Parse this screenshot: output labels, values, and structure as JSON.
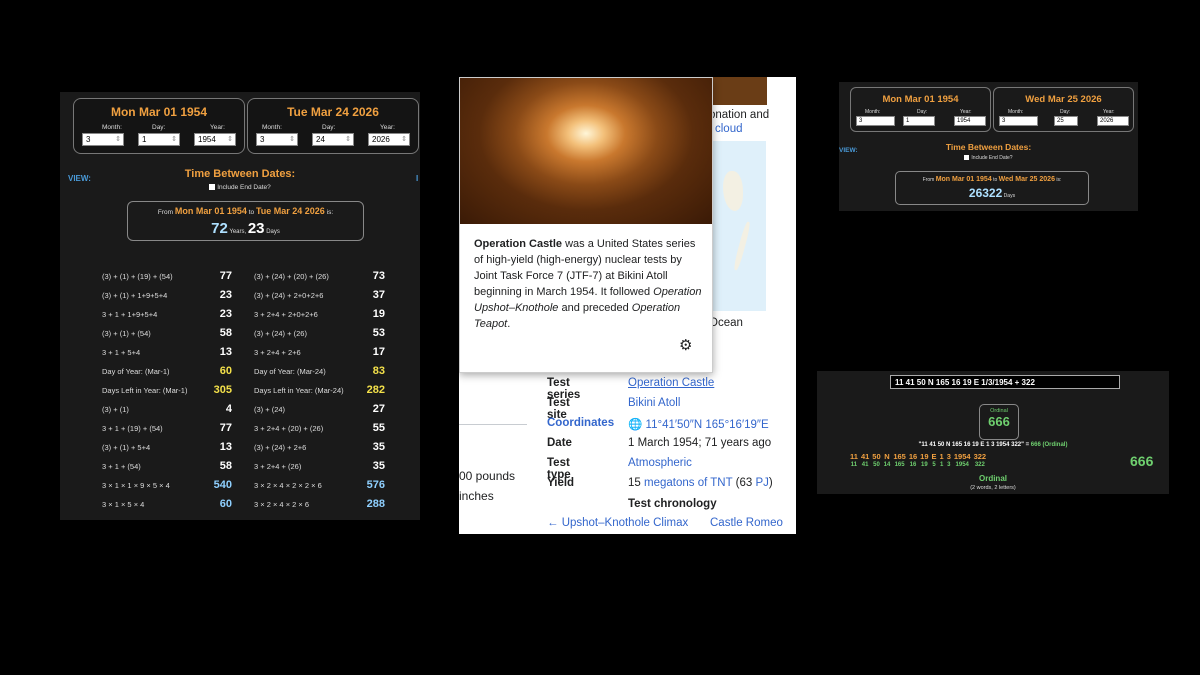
{
  "calc1": {
    "start": {
      "title": "Mon Mar 01 1954",
      "month": "3",
      "day": "1",
      "year": "1954"
    },
    "end": {
      "title": "Tue Mar 24 2026",
      "month": "3",
      "day": "24",
      "year": "2026"
    },
    "labels": {
      "month": "Month:",
      "day": "Day:",
      "year": "Year:"
    },
    "view": "VIEW:",
    "heading": "Time Between Dates:",
    "include": "Include End Date?",
    "from_word": "From",
    "to_word": "to",
    "is_word": "is:",
    "years": "72",
    "years_unit": "Years,",
    "days": "23",
    "days_unit": "Days",
    "left": [
      {
        "e": "(3) + (1) + (19) + (54)",
        "v": "77",
        "c": "cw"
      },
      {
        "e": "(3) + (1) + 1+9+5+4",
        "v": "23",
        "c": "cw"
      },
      {
        "e": "3 + 1 + 1+9+5+4",
        "v": "23",
        "c": "cw"
      },
      {
        "e": "(3) + (1) + (54)",
        "v": "58",
        "c": "cw"
      },
      {
        "e": "3 + 1 + 5+4",
        "v": "13",
        "c": "cw"
      },
      {
        "e": "Day of Year: (Mar-1)",
        "v": "60",
        "c": "cy"
      },
      {
        "e": "Days Left in Year: (Mar-1)",
        "v": "305",
        "c": "cy"
      },
      {
        "e": "(3) + (1)",
        "v": "4",
        "c": "cw"
      },
      {
        "e": "3 + 1 + (19) + (54)",
        "v": "77",
        "c": "cw"
      },
      {
        "e": "(3) + (1) + 5+4",
        "v": "13",
        "c": "cw"
      },
      {
        "e": "3 + 1 + (54)",
        "v": "58",
        "c": "cw"
      },
      {
        "e": "3 × 1 × 1 × 9 × 5 × 4",
        "v": "540",
        "c": "cb"
      },
      {
        "e": "3 × 1 × 5 × 4",
        "v": "60",
        "c": "cb"
      }
    ],
    "right": [
      {
        "e": "(3) + (24) + (20) + (26)",
        "v": "73",
        "c": "cw"
      },
      {
        "e": "(3) + (24) + 2+0+2+6",
        "v": "37",
        "c": "cw"
      },
      {
        "e": "3 + 2+4 + 2+0+2+6",
        "v": "19",
        "c": "cw"
      },
      {
        "e": "(3) + (24) + (26)",
        "v": "53",
        "c": "cw"
      },
      {
        "e": "3 + 2+4 + 2+6",
        "v": "17",
        "c": "cw"
      },
      {
        "e": "Day of Year: (Mar-24)",
        "v": "83",
        "c": "cy"
      },
      {
        "e": "Days Left in Year: (Mar-24)",
        "v": "282",
        "c": "cy"
      },
      {
        "e": "(3) + (24)",
        "v": "27",
        "c": "cw"
      },
      {
        "e": "3 + 2+4 + (20) + (26)",
        "v": "55",
        "c": "cw"
      },
      {
        "e": "(3) + (24) + 2+6",
        "v": "35",
        "c": "cw"
      },
      {
        "e": "3 + 2+4 + (26)",
        "v": "35",
        "c": "cw"
      },
      {
        "e": "3 × 2 × 4 × 2 × 2 × 6",
        "v": "576",
        "c": "cb"
      },
      {
        "e": "3 × 2 × 4 × 2 × 6",
        "v": "288",
        "c": "cb"
      }
    ]
  },
  "wiki": {
    "popup": {
      "title": "Operation Castle",
      "p1": " was a United States series of high-yield (high-energy) nuclear tests by Joint Task Force 7 (JTF-7) at Bikini Atoll beginning in March 1954. It followed ",
      "prev": "Operation Upshot–Knothole",
      "p2": " and preceded ",
      "next": "Operation Teapot",
      "p3": "."
    },
    "bg_text1": "onation and",
    "bg_link1": "cloud",
    "bg_ocean": "Ocean",
    "bg_pounds": "00 pounds",
    "bg_inches": "inches",
    "rows": [
      {
        "k": "Test series",
        "v": "Operation Castle",
        "link": true
      },
      {
        "k": "Test site",
        "v": "Bikini Atoll",
        "link": true
      },
      {
        "k": "Coordinates",
        "v": "11°41′50″N 165°16′19″E",
        "link": true
      },
      {
        "k": "Date",
        "v": "1 March 1954; 71 years ago",
        "link": false
      },
      {
        "k": "Test type",
        "v": "Atmospheric",
        "link": true
      },
      {
        "k": "Yield",
        "v": "15",
        "link": false
      }
    ],
    "yield_link": "megatons of TNT",
    "yield_mid": " (63 ",
    "yield_pj": "PJ",
    "yield_end": ")",
    "chronology": "Test chronology",
    "prev_nav": "← Upshot–Knothole Climax",
    "next_nav": "Castle Romeo →"
  },
  "calc2": {
    "start": {
      "title": "Mon Mar 01 1954",
      "month": "3",
      "day": "1",
      "year": "1954"
    },
    "end": {
      "title": "Wed Mar 25 2026",
      "month": "3",
      "day": "25",
      "year": "2026"
    },
    "labels": {
      "month": "Month:",
      "day": "Day:",
      "year": "Year:"
    },
    "view": "VIEW:",
    "heading": "Time Between Dates:",
    "include": "Include End Date?",
    "from_word": "From",
    "to_word": "to",
    "is_word": "is:",
    "days": "26322",
    "days_unit": "Days"
  },
  "gematria": {
    "input": "11 41 50 N 165 16 19 E 1/3/1954 + 322",
    "ordinal_label": "Ordinal",
    "ordinal_value": "666",
    "equation": "\"11 41 50 N 165 16 19 E 1 3 1954 322\" = ",
    "equation_result": "666 (Ordinal)",
    "tokens": [
      {
        "t": "11",
        "v": "11"
      },
      {
        "t": "41",
        "v": "41"
      },
      {
        "t": "50",
        "v": "50"
      },
      {
        "t": "N",
        "v": "14"
      },
      {
        "t": "165",
        "v": "165"
      },
      {
        "t": "16",
        "v": "16"
      },
      {
        "t": "19",
        "v": "19"
      },
      {
        "t": "E",
        "v": "5"
      },
      {
        "t": "1",
        "v": "1"
      },
      {
        "t": "3",
        "v": "3"
      },
      {
        "t": "1954",
        "v": "1954"
      },
      {
        "t": "322",
        "v": "322"
      }
    ],
    "total": "666",
    "footer_label": "Ordinal",
    "footer_counts": "(2 words, 2 letters)"
  }
}
